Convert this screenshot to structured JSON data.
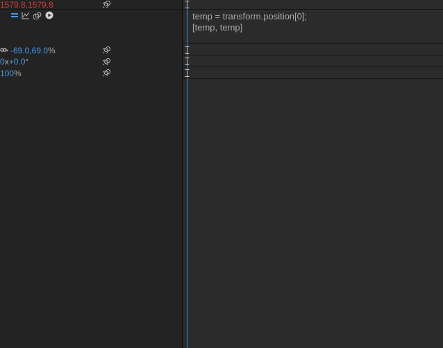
{
  "rows": [
    {
      "id": "scale-expr",
      "value": "1579.8,1579.8",
      "color": "#d33636"
    },
    {
      "id": "anchor",
      "value": "-69.0,69.0",
      "unit": "%",
      "color": "#4a97e8"
    },
    {
      "id": "rotation",
      "prefix": "0",
      "mid": "x",
      "value": "+0.0",
      "unit": "°",
      "color": "#4a97e8"
    },
    {
      "id": "opacity",
      "value": "100",
      "unit": "%",
      "color": "#4a97e8"
    }
  ],
  "expression": {
    "line1": "temp = transform.position[0];",
    "line2": "[temp, temp]"
  },
  "icons": {
    "pickwhip": "spiral-pickwhip-icon",
    "enable": "equals-enable-icon",
    "graph": "graph-icon",
    "pickwhip_small": "spiral-icon",
    "language_menu": "play-menu-icon",
    "link": "link-icon"
  },
  "colors": {
    "accent_blue": "#4a97e8",
    "expression_red": "#d33636",
    "cti": "#3a8bd8"
  }
}
